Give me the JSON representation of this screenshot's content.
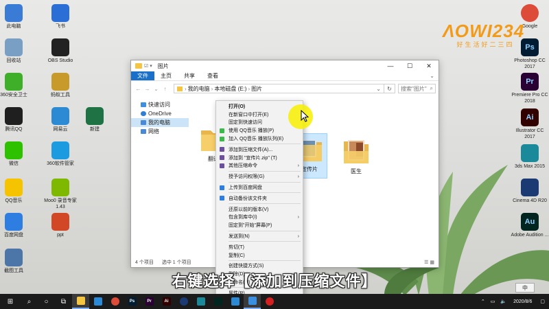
{
  "desktop": {
    "left_icons": [
      {
        "label": "此电脑",
        "icon": "computer-icon",
        "color": "#3a7bd5"
      },
      {
        "label": "飞书",
        "icon": "feishu-icon",
        "color": "#2b6fd6"
      },
      {
        "label": "回收站",
        "icon": "recycle-bin-icon",
        "color": "#7a9fc4"
      },
      {
        "label": "OBS Studio",
        "icon": "obs-icon",
        "color": "#222222"
      },
      {
        "label": "360安全卫士",
        "icon": "360-safe-icon",
        "color": "#3fae29"
      },
      {
        "label": "蚂蚁工具",
        "icon": "ant-icon",
        "color": "#c89a2b"
      },
      {
        "label": "腾讯QQ",
        "icon": "qq-icon",
        "color": "#1f1f1f"
      },
      {
        "label": "网易云",
        "icon": "netease-icon",
        "color": "#2c89d4"
      },
      {
        "label": "微信",
        "icon": "wechat-icon",
        "color": "#2dc100"
      },
      {
        "label": "360软件管家",
        "icon": "360-software-icon",
        "color": "#1d9be1"
      },
      {
        "label": "QQ音乐",
        "icon": "qqmusic-icon",
        "color": "#f6c300"
      },
      {
        "label": "Moo0 录音专家 1.43",
        "icon": "moo0-icon",
        "color": "#7fb800"
      },
      {
        "label": "百度网盘",
        "icon": "baidu-netdisk-icon",
        "color": "#2e7de1"
      },
      {
        "label": "ppt",
        "icon": "ppt-file-icon",
        "color": "#d24726"
      },
      {
        "label": "截图工具",
        "icon": "snipping-tool-icon",
        "color": "#4d76a8"
      },
      {
        "label": "新建",
        "icon": "spreadsheet-file-icon",
        "color": "#1f7244"
      }
    ],
    "right_icons": [
      {
        "label": "Google",
        "icon": "chrome-icon",
        "color": "#dd4b39"
      },
      {
        "label": "Photoshop CC 2017",
        "icon": "photoshop-icon",
        "color": "#001d34",
        "glyph": "Ps"
      },
      {
        "label": "Premiere Pro CC 2018",
        "icon": "premiere-icon",
        "color": "#2a0034",
        "glyph": "Pr"
      },
      {
        "label": "Illustrator CC 2017",
        "icon": "illustrator-icon",
        "color": "#330000",
        "glyph": "Ai"
      },
      {
        "label": "3ds Max 2015",
        "icon": "3dsmax-icon",
        "color": "#1a8a9a"
      },
      {
        "label": "Cinema 4D R20",
        "icon": "cinema4d-icon",
        "color": "#1b3a73"
      },
      {
        "label": "Adobe Audition ...",
        "icon": "audition-icon",
        "color": "#00261f",
        "glyph": "Au"
      }
    ],
    "logo": {
      "text": "ΛΟWI234",
      "sub": "好生活好二三四"
    }
  },
  "explorer": {
    "title": "图片",
    "ribbon_tabs": [
      "文件",
      "主页",
      "共享",
      "查看"
    ],
    "breadcrumb": [
      "我的电脑",
      "本地磁盘 (E:)",
      "图片"
    ],
    "search_placeholder": "搜索\"图片\"",
    "nav": [
      {
        "label": "快速访问",
        "color": "#3d8fe0"
      },
      {
        "label": "OneDrive",
        "color": "#2f7fd6"
      },
      {
        "label": "我的电脑",
        "color": "#4a89d8"
      },
      {
        "label": "网络",
        "color": "#4a89d8"
      }
    ],
    "folders": [
      {
        "label": "翻译"
      },
      {
        "label": "宣传片"
      },
      {
        "label": "医生"
      }
    ],
    "status": {
      "count": "4 个项目",
      "selected": "选中 1 个项目"
    }
  },
  "context_menu": {
    "items": [
      {
        "label": "打开(O)",
        "bold": true
      },
      {
        "label": "在新窗口中打开(E)"
      },
      {
        "label": "固定到快速访问"
      },
      {
        "label": "使用 QQ音乐 播放(P)",
        "icon_color": "#3cb94a"
      },
      {
        "label": "加入 QQ音乐 播放队列(E)",
        "icon_color": "#3cb94a"
      },
      {
        "sep": true
      },
      {
        "label": "添加到压缩文件(A)...",
        "icon_color": "#6b4f9c"
      },
      {
        "label": "添加到 \"宣传片.zip\" (T)",
        "icon_color": "#6b4f9c"
      },
      {
        "label": "其他压缩命令",
        "icon_color": "#6b4f9c",
        "sub": true
      },
      {
        "sep": true
      },
      {
        "label": "授予访问权限(G)",
        "sub": true
      },
      {
        "sep": true
      },
      {
        "label": "上传到百度网盘",
        "icon_color": "#2e7de1"
      },
      {
        "sep": true
      },
      {
        "label": "自动备份该文件夹",
        "icon_color": "#2e7de1"
      },
      {
        "sep": true
      },
      {
        "label": "还原以前的版本(V)"
      },
      {
        "label": "包含到库中(I)",
        "sub": true
      },
      {
        "label": "固定到\"开始\"屏幕(P)"
      },
      {
        "sep": true
      },
      {
        "label": "发送到(N)",
        "sub": true
      },
      {
        "sep": true
      },
      {
        "label": "剪切(T)"
      },
      {
        "label": "复制(C)"
      },
      {
        "sep": true
      },
      {
        "label": "创建快捷方式(S)"
      },
      {
        "label": "删除(D)"
      },
      {
        "label": "重命名(M)"
      },
      {
        "sep": true
      },
      {
        "label": "属性(R)"
      }
    ]
  },
  "subtitle": "右键选择【添加到压缩文件】",
  "taskbar": {
    "apps": [
      {
        "icon": "windows-start-icon"
      },
      {
        "icon": "search-icon"
      },
      {
        "icon": "cortana-icon"
      },
      {
        "icon": "task-view-icon"
      },
      {
        "icon": "file-explorer-icon",
        "active": true
      },
      {
        "icon": "mail-icon"
      },
      {
        "icon": "chrome-icon"
      },
      {
        "icon": "photoshop-icon",
        "glyph": "Ps"
      },
      {
        "icon": "premiere-icon",
        "glyph": "Pr"
      },
      {
        "icon": "illustrator-icon",
        "glyph": "Ai"
      },
      {
        "icon": "cinema4d-icon"
      },
      {
        "icon": "3dsmax-icon"
      },
      {
        "icon": "audition-icon"
      },
      {
        "icon": "netease-icon"
      },
      {
        "icon": "phone-icon",
        "active": true
      },
      {
        "icon": "record-icon"
      }
    ],
    "ime": "中",
    "date": "2020/8/6"
  }
}
